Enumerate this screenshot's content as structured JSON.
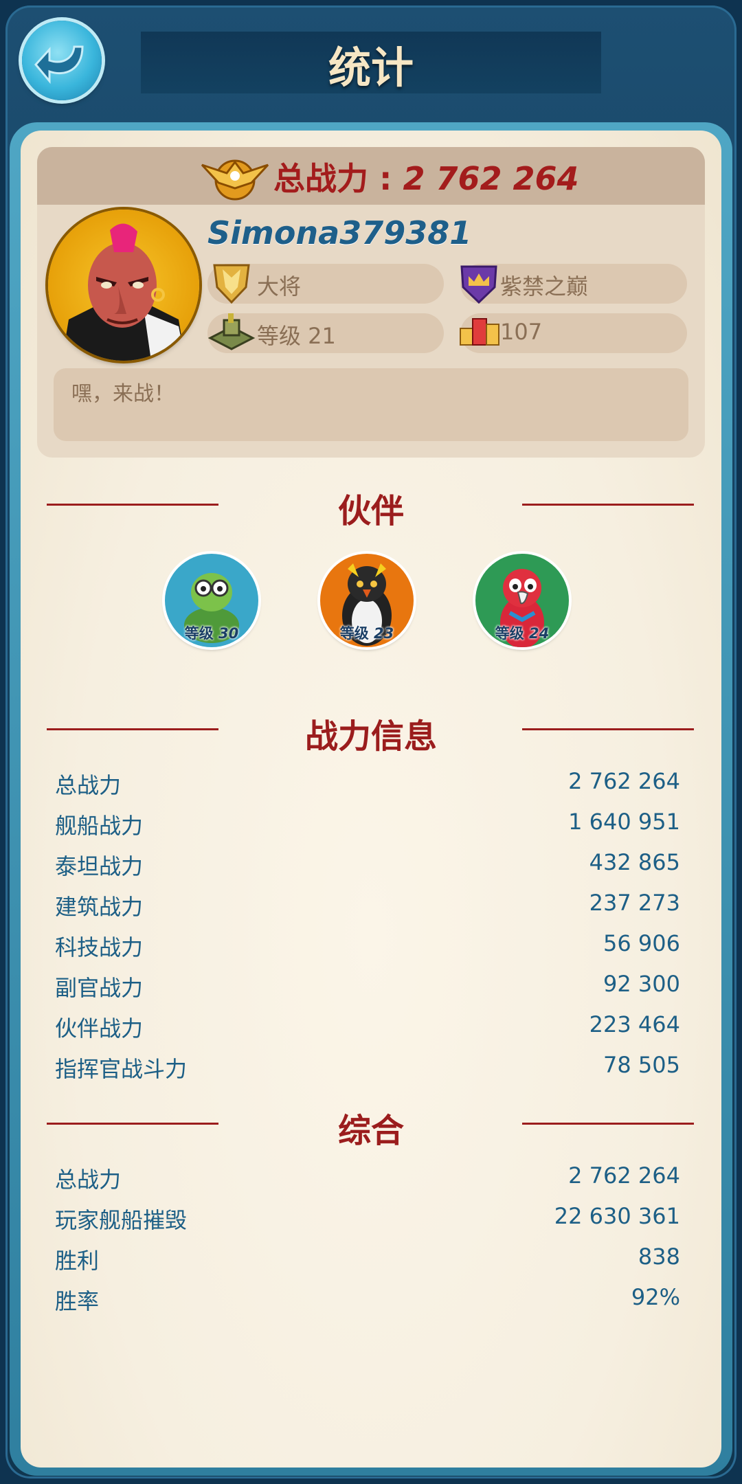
{
  "header": {
    "title": "统计"
  },
  "profile": {
    "total_power_label": "总战力 : ",
    "total_power_value": "2 762 264",
    "username": "Simona379381",
    "rank": "大将",
    "alliance": "紫禁之巅",
    "level": "等级 21",
    "score": "107",
    "motto": "嘿，来战！"
  },
  "partners": {
    "title": "伙伴",
    "items": [
      {
        "level_prefix": "等级 ",
        "level": "30",
        "color": "#3aa7c9"
      },
      {
        "level_prefix": "等级 ",
        "level": "23",
        "color": "#e8760f"
      },
      {
        "level_prefix": "等级 ",
        "level": "24",
        "color": "#2e9a55"
      }
    ]
  },
  "combat": {
    "title": "战力信息",
    "rows": [
      {
        "label": "总战力",
        "value": "2 762 264"
      },
      {
        "label": "舰船战力",
        "value": "1 640 951"
      },
      {
        "label": "泰坦战力",
        "value": "432 865"
      },
      {
        "label": "建筑战力",
        "value": "237 273"
      },
      {
        "label": "科技战力",
        "value": "56 906"
      },
      {
        "label": "副官战力",
        "value": "92 300"
      },
      {
        "label": "伙伴战力",
        "value": "223 464"
      },
      {
        "label": "指挥官战斗力",
        "value": "78 505"
      }
    ]
  },
  "summary": {
    "title": "综合",
    "rows": [
      {
        "label": "总战力",
        "value": "2 762 264"
      },
      {
        "label": "玩家舰船摧毁",
        "value": "22 630 361"
      },
      {
        "label": "胜利",
        "value": "838"
      },
      {
        "label": "胜率",
        "value": "92%"
      }
    ]
  },
  "colors": {
    "accent_red": "#9b1d1d",
    "stat_blue": "#1d5f86",
    "frame": "#14405f"
  }
}
